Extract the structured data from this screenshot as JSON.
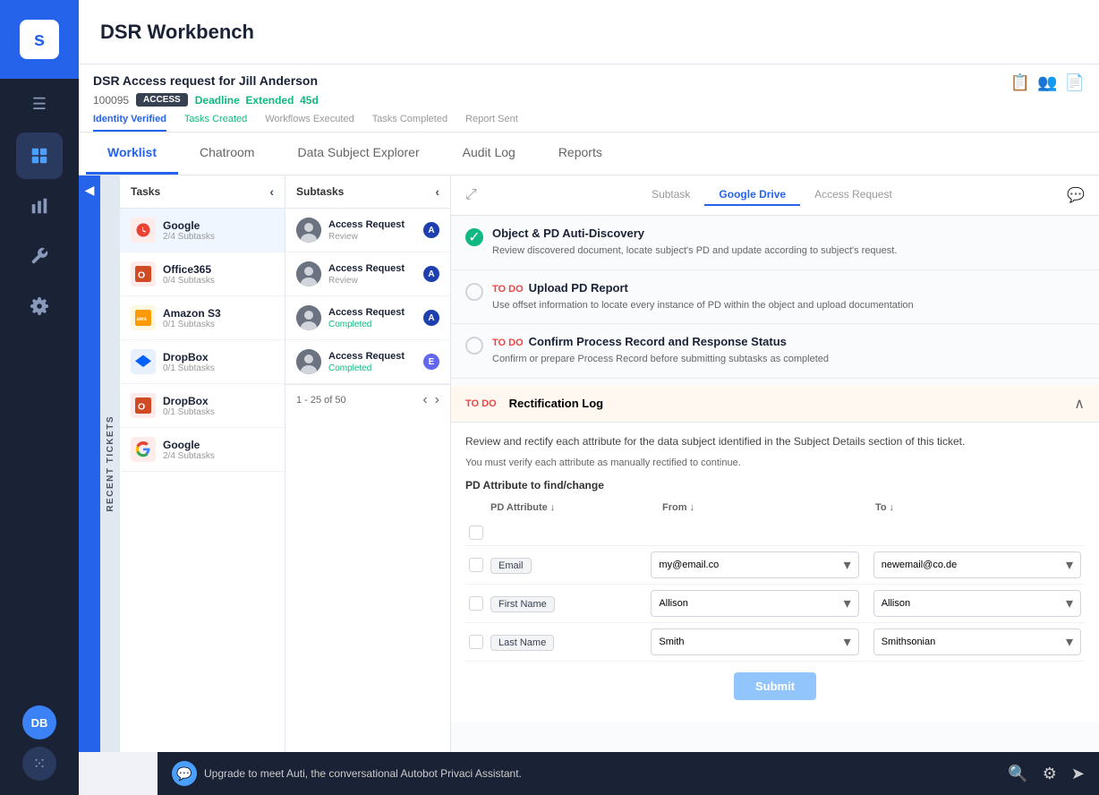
{
  "app": {
    "title": "DSR Workbench",
    "logo_text": "securiti"
  },
  "sidebar": {
    "avatar_initials": "DB",
    "nav_items": [
      {
        "id": "home",
        "icon": "⊞",
        "active": false
      },
      {
        "id": "analytics",
        "icon": "▦",
        "active": false
      },
      {
        "id": "tools",
        "icon": "🔧",
        "active": false
      },
      {
        "id": "settings",
        "icon": "⚙",
        "active": false
      }
    ]
  },
  "ticket": {
    "title": "DSR Access request for Jill Anderson",
    "id": "100095",
    "badge": "ACCESS",
    "deadline_label": "Deadline",
    "deadline_status": "Extended",
    "deadline_days": "45d"
  },
  "progress_tabs": [
    {
      "label": "Identity Verified",
      "state": "active"
    },
    {
      "label": "Tasks Created",
      "state": "completed"
    },
    {
      "label": "Workflows Executed",
      "state": "normal"
    },
    {
      "label": "Tasks Completed",
      "state": "normal"
    },
    {
      "label": "Report Sent",
      "state": "normal"
    }
  ],
  "main_tabs": [
    {
      "label": "Worklist",
      "active": true
    },
    {
      "label": "Chatroom",
      "active": false
    },
    {
      "label": "Data Subject Explorer",
      "active": false
    },
    {
      "label": "Audit Log",
      "active": false
    },
    {
      "label": "Reports",
      "active": false
    }
  ],
  "tasks_panel": {
    "header": "Tasks",
    "items": [
      {
        "name": "Google",
        "sub": "2/4 Subtasks",
        "icon": "G",
        "color": "#ea4335",
        "active": true
      },
      {
        "name": "Office365",
        "sub": "0/4 Subtasks",
        "icon": "O",
        "color": "#d04a23"
      },
      {
        "name": "Amazon S3",
        "sub": "0/1 Subtasks",
        "icon": "aws",
        "color": "#ff9900"
      },
      {
        "name": "DropBox",
        "sub": "0/1 Subtasks",
        "icon": "D",
        "color": "#0061ff"
      },
      {
        "name": "DropBox",
        "sub": "0/1 Subtasks",
        "icon": "D",
        "color": "#0061ff"
      },
      {
        "name": "Google",
        "sub": "2/4 Subtasks",
        "icon": "G",
        "color": "#ea4335"
      }
    ]
  },
  "subtasks_panel": {
    "header": "Subtasks",
    "pagination": "1 - 25 of 50",
    "items": [
      {
        "name": "Access Request",
        "status_badge": "A",
        "status_text": "Review",
        "badge_color": "#1e40af"
      },
      {
        "name": "Access Request",
        "status_badge": "A",
        "status_text": "Review",
        "badge_color": "#1e40af"
      },
      {
        "name": "Access Request",
        "status_badge": "A",
        "status_text": "Completed",
        "badge_color": "#1e40af"
      },
      {
        "name": "Access Request",
        "status_badge": "E",
        "status_text": "Completed",
        "badge_color": "#6366f1"
      }
    ]
  },
  "detail_tabs": [
    {
      "label": "Subtask",
      "active": false
    },
    {
      "label": "Google Drive",
      "active": true
    },
    {
      "label": "Access Request",
      "active": false
    }
  ],
  "tasks_list": [
    {
      "id": 1,
      "done": true,
      "label": "Object & PD Auti-Discovery",
      "desc": "Review discovered document, locate subject's PD and update according to subject's request."
    },
    {
      "id": 2,
      "done": false,
      "todo": true,
      "label": "Upload PD Report",
      "desc": "Use offset information to locate every instance of PD within the object and upload documentation"
    },
    {
      "id": 3,
      "done": false,
      "todo": true,
      "label": "Confirm Process Record and Response Status",
      "desc": "Confirm or prepare Process Record before submitting subtasks as completed"
    }
  ],
  "rectification": {
    "todo_label": "TO DO",
    "title": "Rectification Log",
    "desc": "Review and rectify each attribute for the data subject identified in the Subject Details section of this ticket.",
    "note": "You must verify each attribute as manually rectified to continue.",
    "section_title": "PD Attribute to find/change",
    "table_headers": [
      "PD Attribute",
      "From",
      "To"
    ],
    "rows": [
      {
        "attribute": "Email",
        "from": "my@email.co",
        "to": "newemail@co.de"
      },
      {
        "attribute": "First Name",
        "from": "Allison",
        "to": "Allison"
      },
      {
        "attribute": "Last Name",
        "from": "Smith",
        "to": "Smithsonian"
      }
    ],
    "submit_label": "Submit"
  },
  "bottom_bar": {
    "auti_text": "Upgrade to meet Auti, the conversational Autobot Privaci Assistant.",
    "actions": [
      "search",
      "filter",
      "share"
    ]
  },
  "recent_tickets_label": "RECENT TICKETS"
}
